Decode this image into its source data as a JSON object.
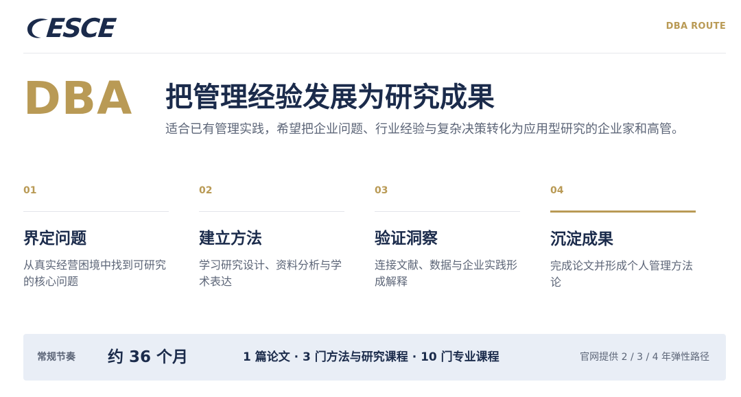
{
  "header": {
    "logo_text": "ESCE",
    "route_label": "DBA ROUTE"
  },
  "hero": {
    "badge": "DBA",
    "title": "把管理经验发展为研究成果",
    "subtitle": "适合已有管理实践，希望把企业问题、行业经验与复杂决策转化为应用型研究的企业家和高管。"
  },
  "steps": [
    {
      "num": "01",
      "title": "界定问题",
      "desc": "从真实经营困境中找到可研究的核心问题"
    },
    {
      "num": "02",
      "title": "建立方法",
      "desc": "学习研究设计、资料分析与学术表达"
    },
    {
      "num": "03",
      "title": "验证洞察",
      "desc": "连接文献、数据与企业实践形成解释"
    },
    {
      "num": "04",
      "title": "沉淀成果",
      "desc": "完成论文并形成个人管理方法论"
    }
  ],
  "summary": {
    "label": "常规节奏",
    "duration": "约 36 个月",
    "courses": "1 篇论文 · 3 门方法与研究课程 · 10 门专业课程",
    "note": "官网提供 2 / 3 / 4 年弹性路径"
  },
  "colors": {
    "navy": "#1b2b4b",
    "gold": "#b99a55",
    "muted": "#5c6577",
    "bar_bg": "#e9eef6"
  }
}
